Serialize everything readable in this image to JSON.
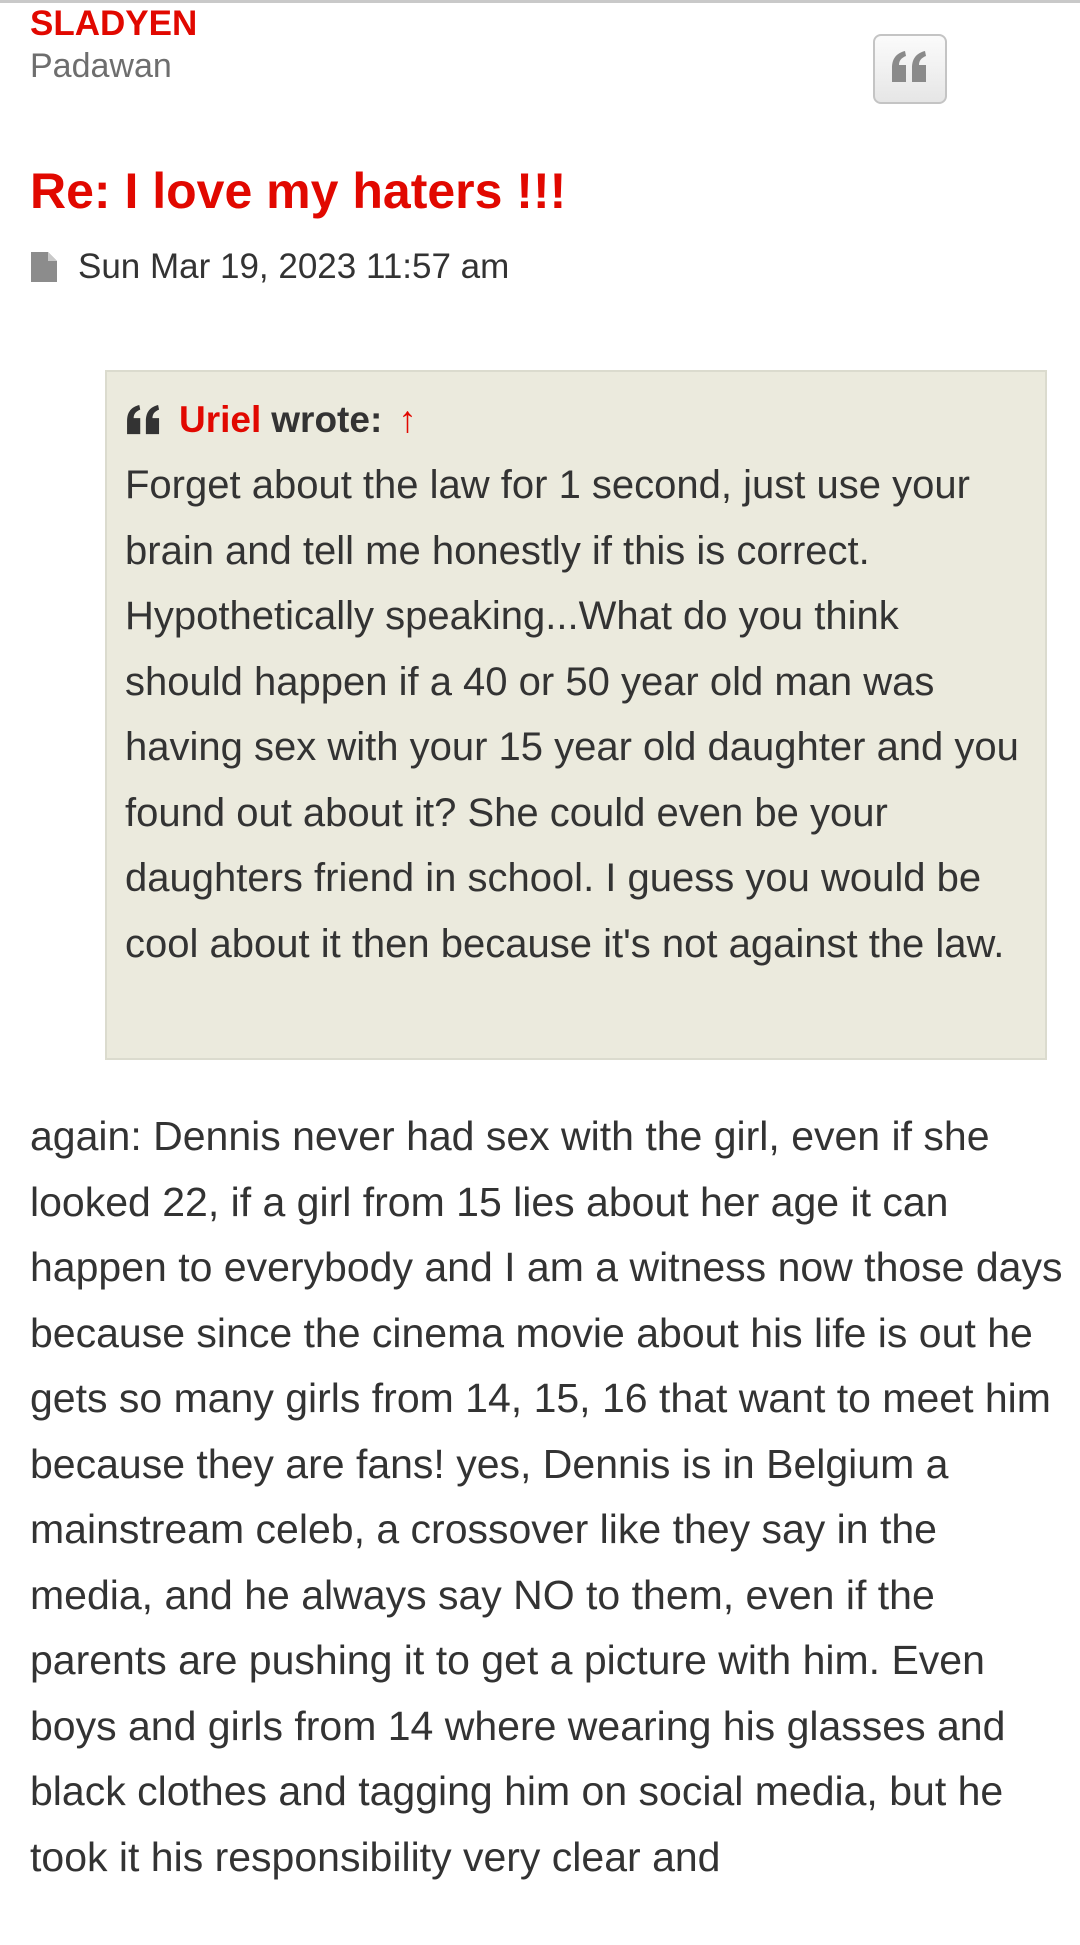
{
  "post": {
    "author": "SLADYEN",
    "rank": "Padawan",
    "title": "Re: I love my haters !!!",
    "date": "Sun Mar 19, 2023 11:57 am",
    "quote_button_icon": "quote-icon",
    "meta_icon": "file-icon"
  },
  "quote": {
    "icon": "quote-icon",
    "author": "Uriel",
    "wrote": "wrote:",
    "arrow": "↑",
    "text": "Forget about the law for 1 second, just use your brain and tell me honestly if this is correct. Hypothetically speaking...What do you think should happen if a 40 or 50 year old man was having sex with your 15 year old daughter and you found out about it? She could even be your daughters friend in school. I guess you would be cool about it then because it's not against the law."
  },
  "content": {
    "text": "again: Dennis never had sex with the girl, even if she looked 22, if a girl from 15 lies about her age it can happen to everybody and I am a witness now those days because since the cinema movie about his life is out he gets so many girls from 14, 15, 16 that want to meet him because they are fans! yes, Dennis is in Belgium a mainstream celeb, a crossover like they say in the media, and he always say NO to them, even if the parents are pushing it to get a picture with him. Even boys and girls from 14 where wearing his glasses and black clothes and tagging him on social media, but he took it his responsibility very clear and"
  },
  "colors": {
    "accent": "#e10800",
    "text": "#333333",
    "quote_bg": "#ebeadd",
    "muted": "#6e6e6e"
  }
}
